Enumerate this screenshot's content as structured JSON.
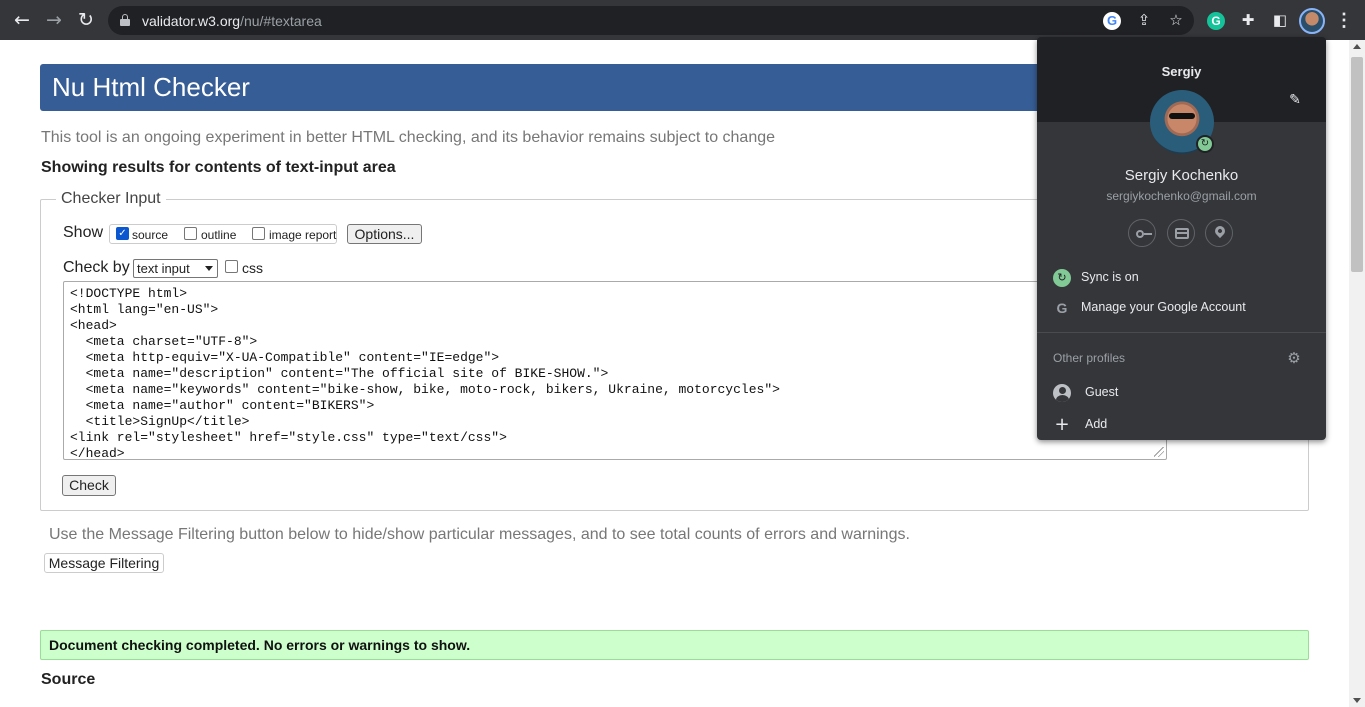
{
  "browser": {
    "url_host": "validator.w3.org",
    "url_path": "/nu/#textarea",
    "icons": {
      "back": "back-arrow-icon",
      "forward": "forward-arrow-icon",
      "reload": "reload-icon",
      "lock": "lock-icon",
      "google": "G",
      "share": "share-icon",
      "star": "star-icon",
      "grammarly": "G",
      "extensions": "puzzle-icon",
      "sidepanel": "side-panel-icon",
      "menu": "⋮"
    }
  },
  "page": {
    "title": "Nu Html Checker",
    "intro": "This tool is an ongoing experiment in better HTML checking, and its behavior remains subject to change",
    "showing": "Showing results for contents of text-input area",
    "checker_input": {
      "legend": "Checker Input",
      "show_label": "Show",
      "options": [
        {
          "label": "source",
          "checked": true
        },
        {
          "label": "outline",
          "checked": false
        },
        {
          "label": "image report",
          "checked": false
        }
      ],
      "options_button": "Options...",
      "check_by_label": "Check by",
      "check_by_value": "text input",
      "css_label": "css",
      "css_checked": false,
      "code_lines": [
        "<!DOCTYPE html>",
        "<html lang=\"en-US\">",
        "<head>",
        "  <meta charset=\"UTF-8\">",
        "  <meta http-equiv=\"X-UA-Compatible\" content=\"IE=edge\">",
        "  <meta name=\"description\" content=\"The official site of BIKE-SHOW.\">",
        "  <meta name=\"keywords\" content=\"bike-show, bike, moto-rock, bikers, Ukraine, motorcycles\">",
        "  <meta name=\"author\" content=\"BIKERS\">",
        "  <title>SignUp</title>",
        "<link rel=\"stylesheet\" href=\"style.css\" type=\"text/css\">",
        "</head>"
      ],
      "check_button": "Check"
    },
    "filter_note": "Use the Message Filtering button below to hide/show particular messages, and to see total counts of errors and warnings.",
    "filter_button": "Message Filtering",
    "success_message": "Document checking completed. No errors or warnings to show.",
    "source_heading": "Source"
  },
  "profile": {
    "name": "Sergiy",
    "full_name": "Sergiy Kochenko",
    "email": "sergiykochenko@gmail.com",
    "sync": "Sync is on",
    "manage": "Manage your Google Account",
    "other_profiles": "Other profiles",
    "guest": "Guest",
    "add": "Add",
    "sync_glyph": "↻",
    "google_glyph": "G",
    "plus_glyph": "+",
    "edit_glyph": "✎",
    "gear_glyph": "⚙"
  },
  "colors": {
    "header": "#365d95",
    "success_bg": "#ccffcc",
    "toolbar": "#35363a",
    "popup": "#35363a"
  }
}
